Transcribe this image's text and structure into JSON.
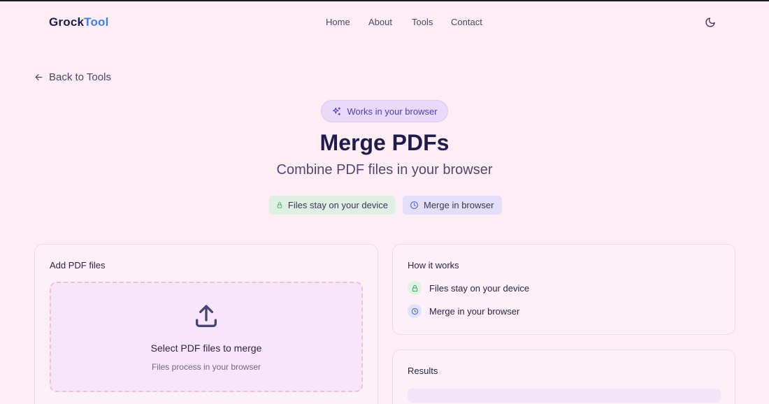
{
  "brand": {
    "part1": "Grock",
    "part2": "Tool"
  },
  "nav": {
    "items": [
      "Home",
      "About",
      "Tools",
      "Contact"
    ]
  },
  "header": {
    "theme_icon": "moon-icon"
  },
  "back": {
    "label": "Back to Tools"
  },
  "badge": {
    "label": "Works in your browser",
    "icon": "sparkles-icon"
  },
  "hero": {
    "title": "Merge PDFs",
    "subtitle": "Combine PDF files in your browser"
  },
  "chips": [
    {
      "label": "Files stay on your device",
      "icon": "lock-icon",
      "color": "#e0efe4"
    },
    {
      "label": "Merge in browser",
      "icon": "clock-icon",
      "color": "#e3defa"
    }
  ],
  "add_card": {
    "title": "Add PDF files",
    "drop_title": "Select PDF files to merge",
    "drop_subtitle": "Files process in your browser",
    "icon": "upload-icon"
  },
  "how_card": {
    "title": "How it works",
    "items": [
      {
        "label": "Files stay on your device",
        "icon": "lock-icon"
      },
      {
        "label": "Merge in your browser",
        "icon": "clock-icon"
      }
    ]
  },
  "results_card": {
    "title": "Results"
  },
  "colors": {
    "background": "#fdeef6",
    "brand_dark": "#1f1b4d",
    "brand_accent": "#3b7ff5",
    "badge_text": "#4a3fc4",
    "green_chip": "#e0efe4",
    "blue_chip": "#e3defa"
  }
}
